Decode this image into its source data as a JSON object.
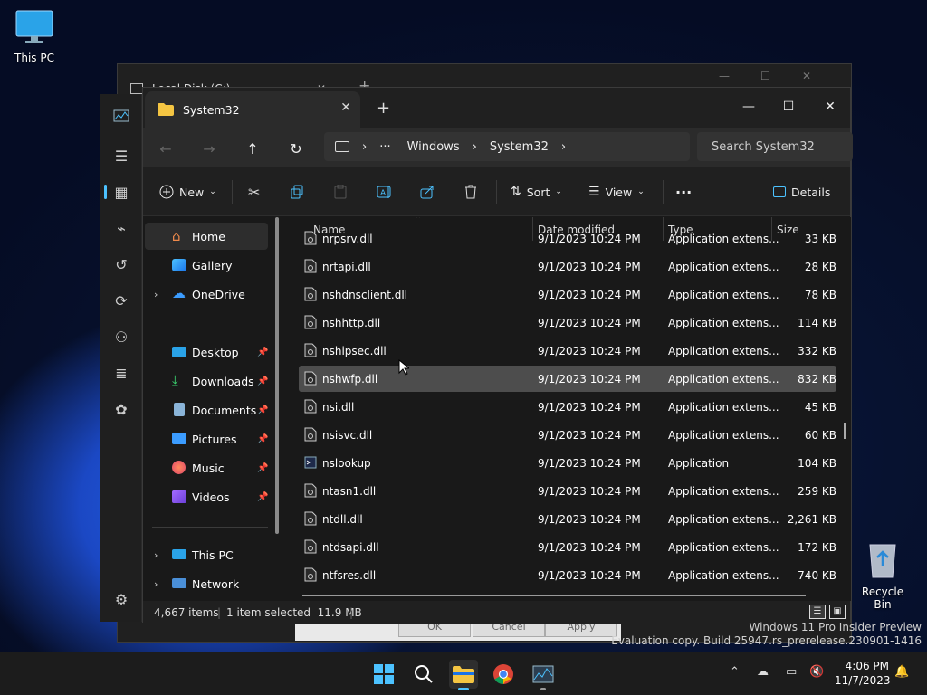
{
  "desktop": {
    "this_pc_label": "This PC",
    "recycle_bin_label": "Recycle Bin"
  },
  "back_window": {
    "tab_title": "Local Disk (C:)",
    "dialog_buttons": [
      "OK",
      "Cancel",
      "Apply"
    ]
  },
  "window": {
    "tab_title": "System32",
    "breadcrumb": [
      "Windows",
      "System32"
    ],
    "breadcrumb_more": "···",
    "search_placeholder": "Search System32"
  },
  "commandbar": {
    "new_label": "New",
    "sort_label": "Sort",
    "view_label": "View",
    "more_label": "···",
    "details_label": "Details"
  },
  "nav": {
    "home": "Home",
    "gallery": "Gallery",
    "onedrive": "OneDrive",
    "desktop": "Desktop",
    "downloads": "Downloads",
    "documents": "Documents",
    "pictures": "Pictures",
    "music": "Music",
    "videos": "Videos",
    "this_pc": "This PC",
    "network": "Network"
  },
  "columns": {
    "name": "Name",
    "date": "Date modified",
    "type": "Type",
    "size": "Size"
  },
  "files": [
    {
      "name": "nrpsrv.dll",
      "date": "9/1/2023 10:24 PM",
      "type": "Application extens...",
      "size": "33 KB",
      "selected": false
    },
    {
      "name": "nrtapi.dll",
      "date": "9/1/2023 10:24 PM",
      "type": "Application extens...",
      "size": "28 KB",
      "selected": false
    },
    {
      "name": "nshdnsclient.dll",
      "date": "9/1/2023 10:24 PM",
      "type": "Application extens...",
      "size": "78 KB",
      "selected": false
    },
    {
      "name": "nshhttp.dll",
      "date": "9/1/2023 10:24 PM",
      "type": "Application extens...",
      "size": "114 KB",
      "selected": false
    },
    {
      "name": "nshipsec.dll",
      "date": "9/1/2023 10:24 PM",
      "type": "Application extens...",
      "size": "332 KB",
      "selected": false
    },
    {
      "name": "nshwfp.dll",
      "date": "9/1/2023 10:24 PM",
      "type": "Application extens...",
      "size": "832 KB",
      "selected": true
    },
    {
      "name": "nsi.dll",
      "date": "9/1/2023 10:24 PM",
      "type": "Application extens...",
      "size": "45 KB",
      "selected": false
    },
    {
      "name": "nsisvc.dll",
      "date": "9/1/2023 10:24 PM",
      "type": "Application extens...",
      "size": "60 KB",
      "selected": false
    },
    {
      "name": "nslookup",
      "date": "9/1/2023 10:24 PM",
      "type": "Application",
      "size": "104 KB",
      "selected": false
    },
    {
      "name": "ntasn1.dll",
      "date": "9/1/2023 10:24 PM",
      "type": "Application extens...",
      "size": "259 KB",
      "selected": false
    },
    {
      "name": "ntdll.dll",
      "date": "9/1/2023 10:24 PM",
      "type": "Application extens...",
      "size": "2,261 KB",
      "selected": false
    },
    {
      "name": "ntdsapi.dll",
      "date": "9/1/2023 10:24 PM",
      "type": "Application extens...",
      "size": "172 KB",
      "selected": false
    },
    {
      "name": "ntfsres.dll",
      "date": "9/1/2023 10:24 PM",
      "type": "Application extens...",
      "size": "740 KB",
      "selected": false
    }
  ],
  "status": {
    "item_count": "4,667 items",
    "selection": "1 item selected  11.9 MB"
  },
  "watermark": {
    "line1": "Windows 11 Pro Insider Preview",
    "line2": "Evaluation copy. Build 25947.rs_prerelease.230901-1416"
  },
  "clock": {
    "time": "4:06 PM",
    "date": "11/7/2023"
  },
  "colors": {
    "accent": "#4cc2ff",
    "folder": "#f4c542",
    "window_bg": "#191919",
    "selected_row": "#4d4d4d"
  }
}
